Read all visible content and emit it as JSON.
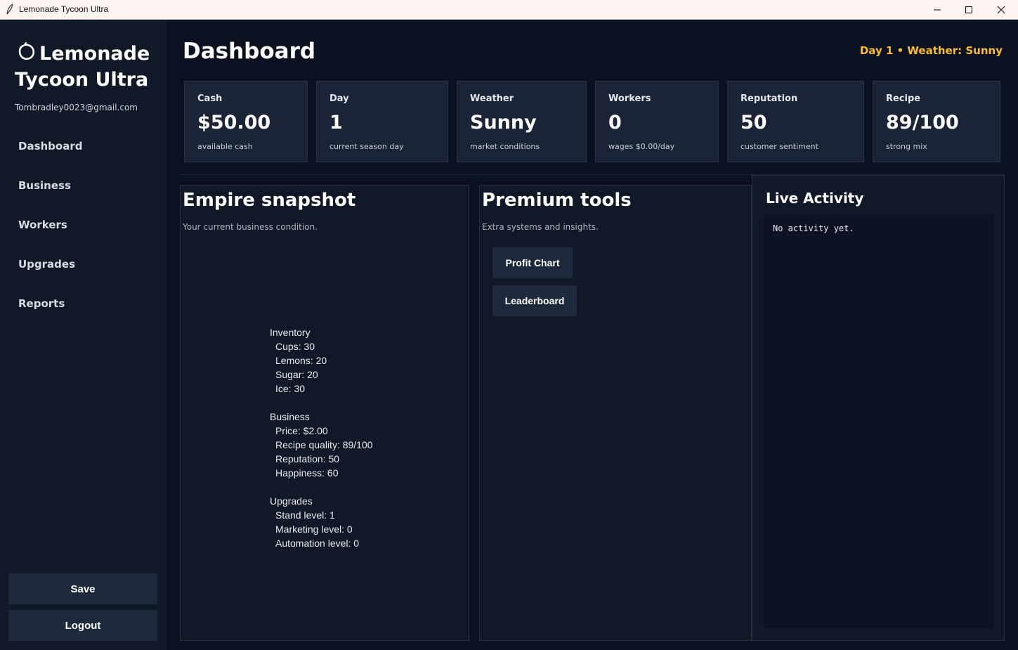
{
  "window": {
    "title": "Lemonade Tycoon Ultra",
    "controls": [
      "minimize-icon",
      "maximize-icon",
      "close-icon"
    ]
  },
  "sidebar": {
    "brand_line1": "Lemonade",
    "brand_line2": "Tycoon Ultra",
    "brand_icon": "lemon-icon",
    "email": "Tombradley0023@gmail.com",
    "nav": [
      {
        "label": "Dashboard"
      },
      {
        "label": "Business"
      },
      {
        "label": "Workers"
      },
      {
        "label": "Upgrades"
      },
      {
        "label": "Reports"
      }
    ],
    "save_label": "Save",
    "logout_label": "Logout"
  },
  "header": {
    "title": "Dashboard",
    "status": "Day 1 • Weather: Sunny"
  },
  "stats": [
    {
      "label": "Cash",
      "value": "$50.00",
      "sub": "available cash"
    },
    {
      "label": "Day",
      "value": "1",
      "sub": "current season day"
    },
    {
      "label": "Weather",
      "value": "Sunny",
      "sub": "market conditions"
    },
    {
      "label": "Workers",
      "value": "0",
      "sub": "wages $0.00/day"
    },
    {
      "label": "Reputation",
      "value": "50",
      "sub": "customer sentiment"
    },
    {
      "label": "Recipe",
      "value": "89/100",
      "sub": "strong mix"
    }
  ],
  "empire": {
    "title": "Empire snapshot",
    "subtitle": "Your current business condition.",
    "inventory": {
      "heading": "Inventory",
      "items": [
        "Cups: 30",
        "Lemons: 20",
        "Sugar: 20",
        "Ice: 30"
      ]
    },
    "business": {
      "heading": "Business",
      "items": [
        "Price: $2.00",
        "Recipe quality: 89/100",
        "Reputation: 50",
        "Happiness: 60"
      ]
    },
    "upgrades": {
      "heading": "Upgrades",
      "items": [
        "Stand level: 1",
        "Marketing level: 0",
        "Automation level: 0"
      ]
    }
  },
  "premium": {
    "title": "Premium tools",
    "subtitle": "Extra systems and insights.",
    "profit_chart_label": "Profit Chart",
    "leaderboard_label": "Leaderboard"
  },
  "activity": {
    "title": "Live Activity",
    "text": "No activity yet."
  },
  "colors": {
    "background": "#0b1120",
    "sidebar": "#111827",
    "card": "#1a2436",
    "button": "#1e293b",
    "accent": "#fbbf24"
  }
}
